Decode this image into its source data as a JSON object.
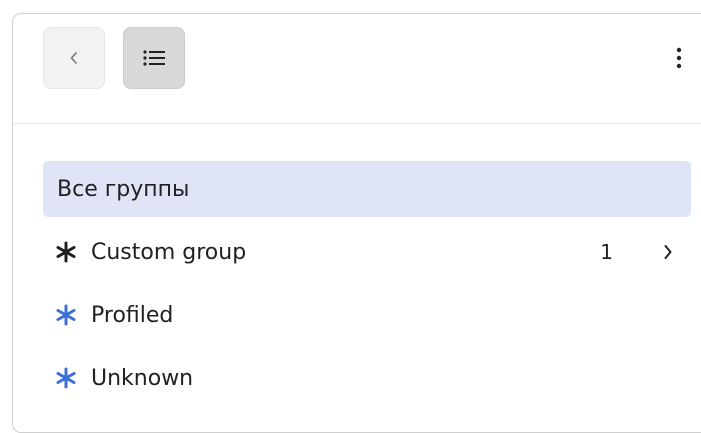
{
  "toolbar": {
    "back_icon": "chevron-left-icon",
    "list_icon": "list-icon",
    "more_icon": "kebab-menu-icon"
  },
  "groups": {
    "all_label": "Все группы",
    "items": [
      {
        "label": "Custom group",
        "count": "1",
        "icon": "asterisk-icon",
        "icon_color": "#1f1f1f",
        "has_chevron": true
      },
      {
        "label": "Profiled",
        "icon": "asterisk-icon",
        "icon_color": "#3c6fd6"
      },
      {
        "label": "Unknown",
        "icon": "asterisk-icon",
        "icon_color": "#3c6fd6"
      }
    ]
  },
  "colors": {
    "active_bg": "#dfe4f7",
    "accent_blue": "#3c6fd6"
  }
}
